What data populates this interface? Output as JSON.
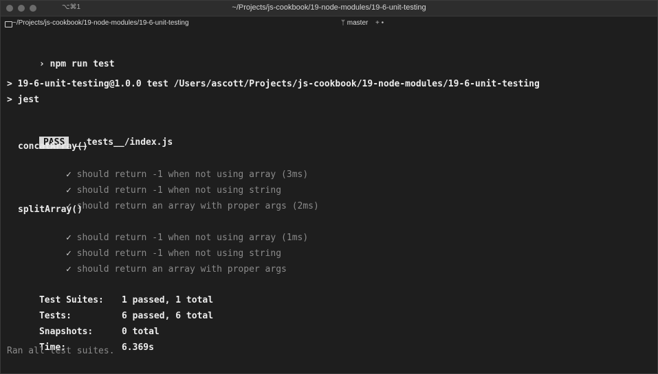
{
  "window": {
    "shortcut": "⌥⌘1",
    "title": "~/Projects/js-cookbook/19-node-modules/19-6-unit-testing"
  },
  "tabbar": {
    "path": "~/Projects/js-cookbook/19-node-modules/19-6-unit-testing",
    "branch": "master",
    "status": "+ •"
  },
  "terminal": {
    "prompt": "›",
    "command": "npm run test",
    "script_line": "> 19-6-unit-testing@1.0.0 test /Users/ascott/Projects/js-cookbook/19-node-modules/19-6-unit-testing",
    "jest_line": "> jest",
    "pass_badge": "PASS",
    "test_file": "__tests__/index.js",
    "suites": [
      {
        "name": "concatArray()",
        "tests": [
          "should return -1 when not using array (3ms)",
          "should return -1 when not using string",
          "should return an array with proper args (2ms)"
        ]
      },
      {
        "name": "splitArray()",
        "tests": [
          "should return -1 when not using array (1ms)",
          "should return -1 when not using string",
          "should return an array with proper args"
        ]
      }
    ],
    "check_mark": "✓",
    "summary": [
      {
        "label": "Test Suites:",
        "value": "1 passed, 1 total"
      },
      {
        "label": "Tests:",
        "value": "6 passed, 6 total"
      },
      {
        "label": "Snapshots:",
        "value": "0 total"
      },
      {
        "label": "Time:",
        "value": "6.369s"
      }
    ],
    "footer": "Ran all test suites."
  }
}
